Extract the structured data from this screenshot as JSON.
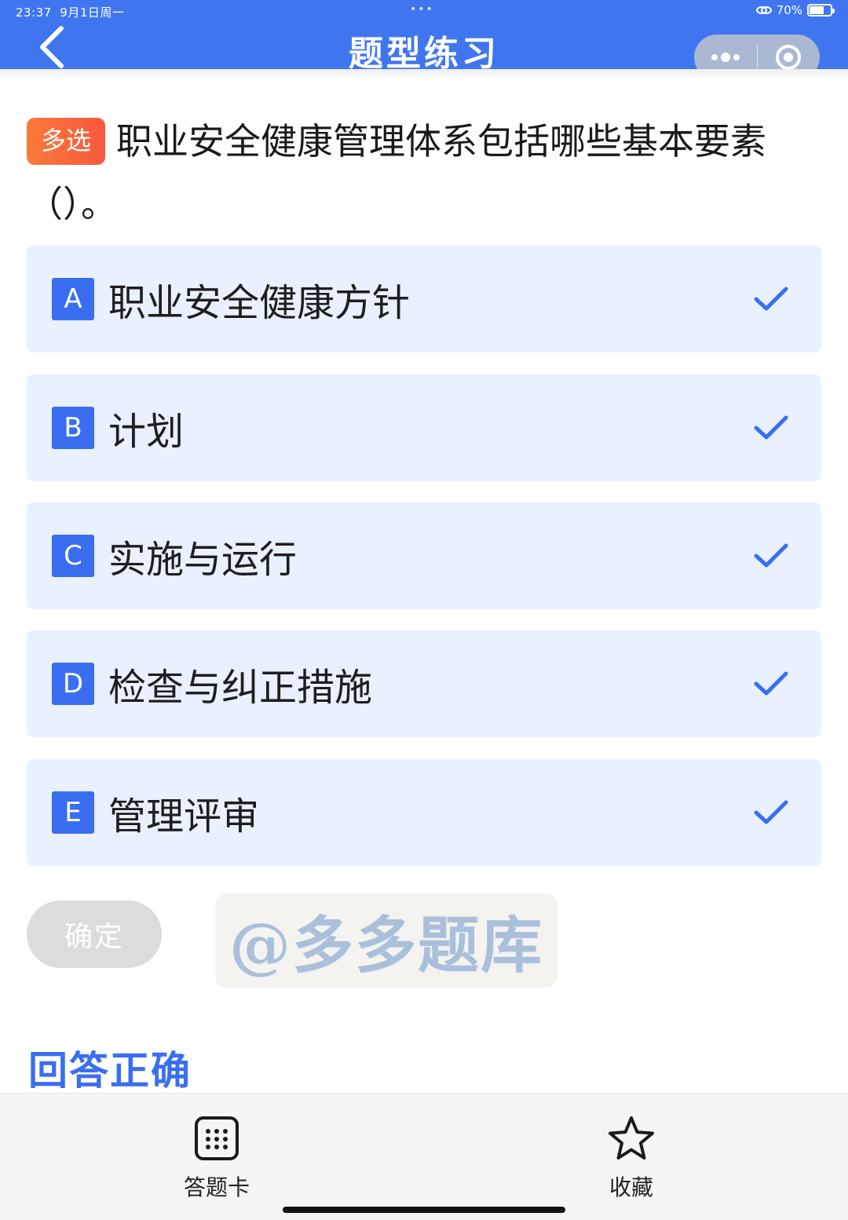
{
  "status_bar": {
    "time": "23:37",
    "date": "9月1日周一",
    "dots": "•••",
    "battery": "70%"
  },
  "header": {
    "title": "题型练习",
    "back_icon": "chevron-left-icon",
    "more_icon": "more-dots-icon",
    "close_icon": "target-circle-icon",
    "color": "#3f76f0"
  },
  "question": {
    "tag": "多选",
    "text": "职业安全健康管理体系包括哪些基本要素（）。"
  },
  "options": [
    {
      "letter": "A",
      "text": "职业安全健康方针",
      "checked": true
    },
    {
      "letter": "B",
      "text": "计划",
      "checked": true
    },
    {
      "letter": "C",
      "text": "实施与运行",
      "checked": true
    },
    {
      "letter": "D",
      "text": "检查与纠正措施",
      "checked": true
    },
    {
      "letter": "E",
      "text": "管理评审",
      "checked": true
    }
  ],
  "confirm_button": "确定",
  "watermark": "@多多题库",
  "result": "回答正确",
  "bottom_bar": {
    "answer_card": "答题卡",
    "favorite": "收藏"
  },
  "colors": {
    "accent": "#3a6ef0",
    "option_bg": "#e9f0ff",
    "tag": "#f7583e"
  }
}
